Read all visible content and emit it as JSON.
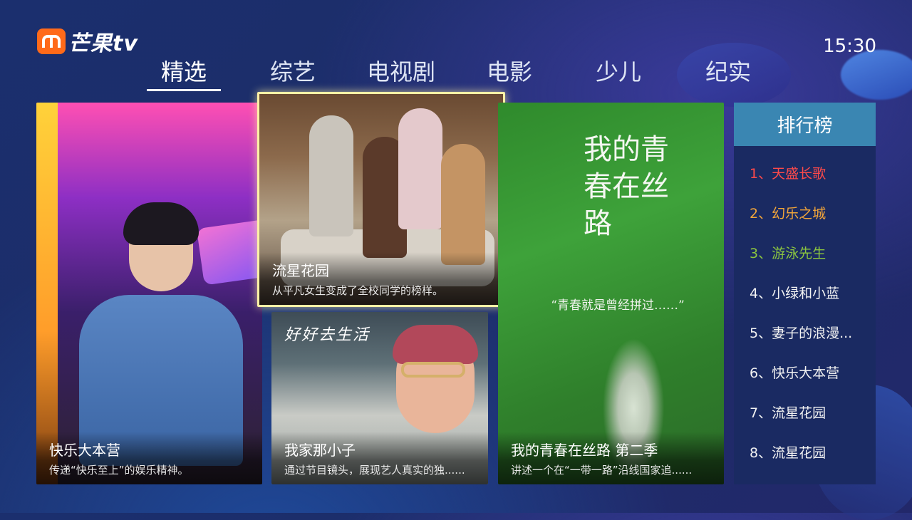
{
  "brand": {
    "name": "芒果tv"
  },
  "clock": "15:30",
  "tabs": [
    {
      "label": "精选",
      "active": true
    },
    {
      "label": "综艺"
    },
    {
      "label": "电视剧"
    },
    {
      "label": "电影"
    },
    {
      "label": "少儿"
    },
    {
      "label": "纪实"
    }
  ],
  "cards": {
    "happy_camp": {
      "title": "快乐大本营",
      "subtitle": "传递“快乐至上”的娱乐精神。"
    },
    "meteor_garden": {
      "title": "流星花园",
      "subtitle": "从平凡女生变成了全校同学的榜样。"
    },
    "my_boy": {
      "title": "我家那小子",
      "subtitle": "通过节目镜头，展现艺人真实的独......",
      "poster_script": "好好去生活"
    },
    "youth_road": {
      "title": "我的青春在丝路 第二季",
      "subtitle": "讲述一个在“一带一路”沿线国家追......",
      "poster_title": "我的青春在丝路",
      "poster_quote": "“青春就是曾经拼过……”"
    }
  },
  "ranking": {
    "header": "排行榜",
    "items": [
      {
        "label": "1、天盛长歌",
        "color": "#ff4a4a"
      },
      {
        "label": "2、幻乐之城",
        "color": "#f2a53a"
      },
      {
        "label": "3、游泳先生",
        "color": "#8cc63f"
      },
      {
        "label": "4、小绿和小蓝",
        "color": "#f2f2f2"
      },
      {
        "label": "5、妻子的浪漫...",
        "color": "#f2f2f2"
      },
      {
        "label": "6、快乐大本营",
        "color": "#f2f2f2"
      },
      {
        "label": "7、流星花园",
        "color": "#f2f2f2"
      },
      {
        "label": "8、流星花园",
        "color": "#f2f2f2"
      }
    ]
  },
  "colors": {
    "focus_border": "#fff1a6",
    "rank_header": "#3a86b2",
    "brand_orange": "#ff6a1a"
  }
}
